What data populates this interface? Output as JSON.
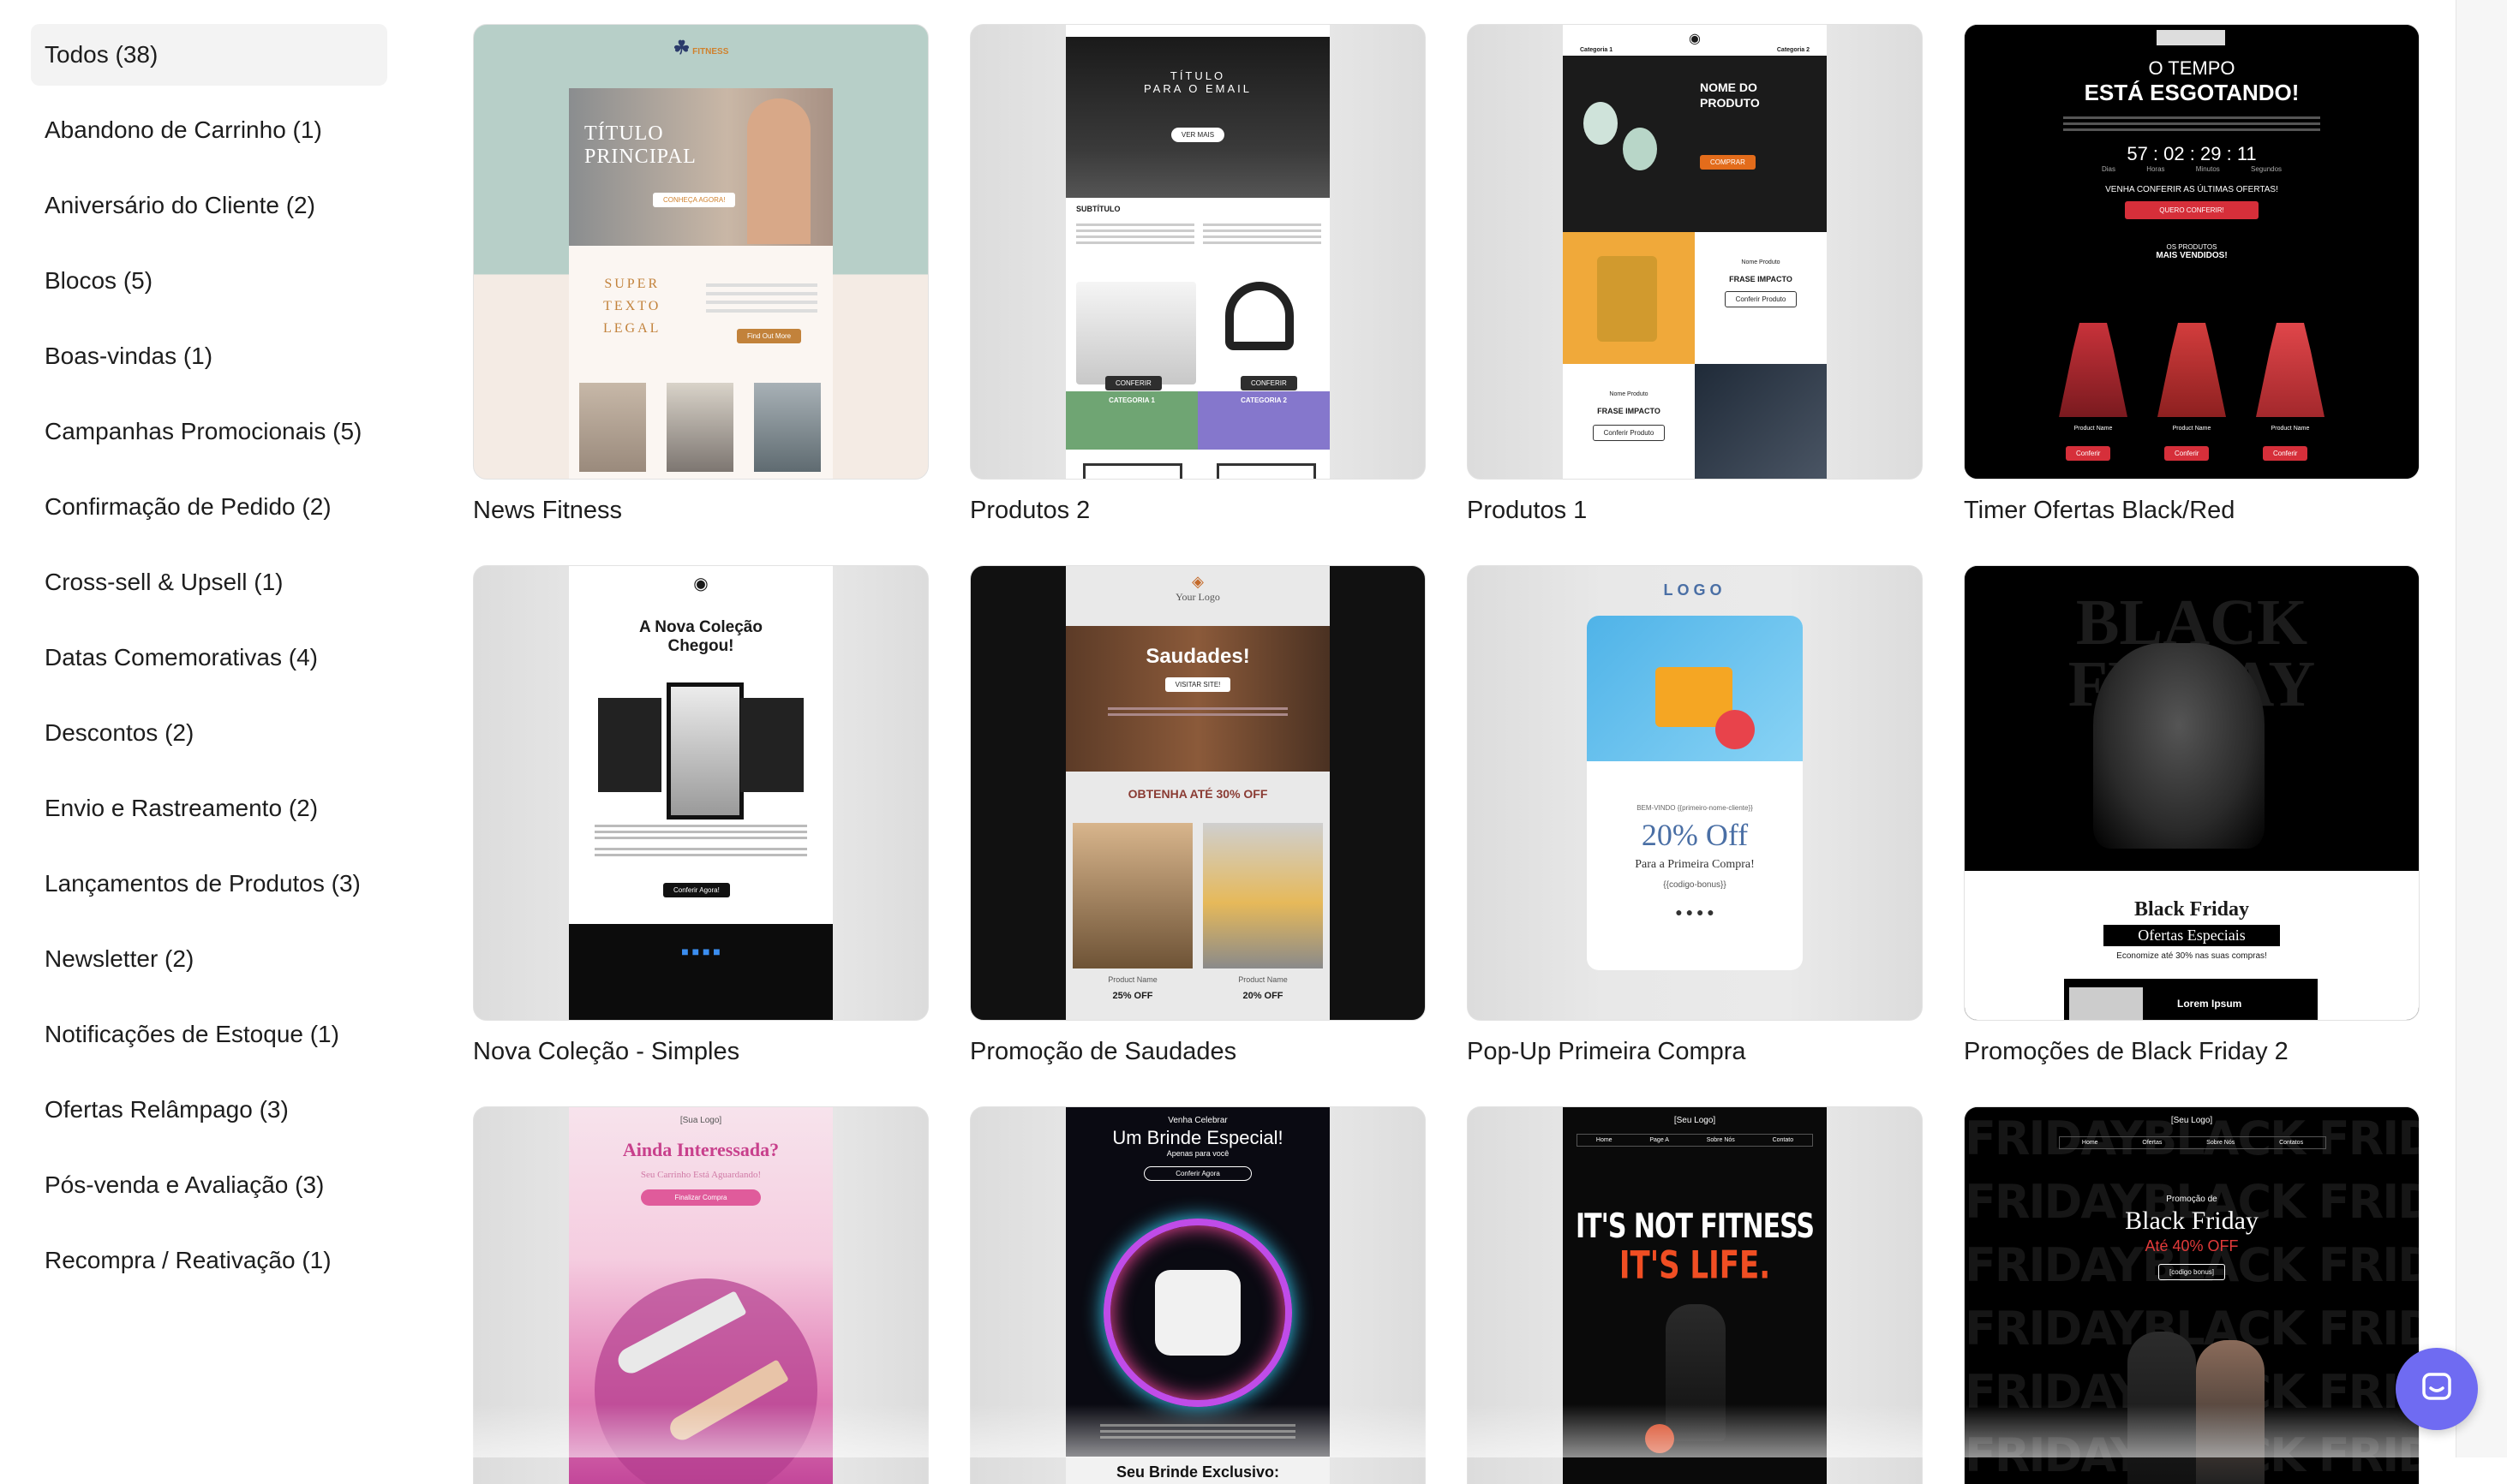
{
  "sidebar": {
    "categories": [
      {
        "label": "Todos (38)"
      },
      {
        "label": "Abandono de Carrinho (1)"
      },
      {
        "label": "Aniversário do Cliente (2)"
      },
      {
        "label": "Blocos (5)"
      },
      {
        "label": "Boas-vindas (1)"
      },
      {
        "label": "Campanhas Promocionais (5)"
      },
      {
        "label": "Confirmação de Pedido (2)"
      },
      {
        "label": "Cross-sell & Upsell (1)"
      },
      {
        "label": "Datas Comemorativas (4)"
      },
      {
        "label": "Descontos (2)"
      },
      {
        "label": "Envio e Rastreamento (2)"
      },
      {
        "label": "Lançamentos de Produtos (3)"
      },
      {
        "label": "Newsletter (2)"
      },
      {
        "label": "Notificações de Estoque (1)"
      },
      {
        "label": "Ofertas Relâmpago (3)"
      },
      {
        "label": "Pós-venda e Avaliação (3)"
      },
      {
        "label": "Recompra / Reativação (1)"
      }
    ]
  },
  "templates": [
    {
      "title": "News Fitness",
      "preview": {
        "brand": "FITNESS",
        "heading1": "TÍTULO",
        "heading2": "PRINCIPAL",
        "cta": "CONHEÇA AGORA!",
        "subheading": [
          "SUPER",
          "TEXTO",
          "LEGAL"
        ],
        "button": "Find Out More"
      }
    },
    {
      "title": "Produtos 2",
      "preview": {
        "heading1": "TÍTULO",
        "heading2": "PARA O EMAIL",
        "cta": "VER MAIS",
        "subtitle": "SUBTÍTULO",
        "btn": "CONFERIR",
        "cat1": "CATEGORIA 1",
        "cat2": "CATEGORIA 2"
      }
    },
    {
      "title": "Produtos 1",
      "preview": {
        "tab1": "Categoria 1",
        "tab2": "Categoria 2",
        "name1": "NOME DO",
        "name2": "PRODUTO",
        "buy": "COMPRAR",
        "small": "Nome Produto",
        "impact": "FRASE IMPACTO",
        "btn": "Conferir Produto"
      }
    },
    {
      "title": "Timer Ofertas Black/Red",
      "preview": {
        "pre": "O TEMPO",
        "headline": "ESTÁ ESGOTANDO!",
        "d": "57",
        "h": "02",
        "m": "29",
        "s": "11",
        "dl": "Dias",
        "hl": "Horas",
        "ml": "Minutos",
        "sl": "Segundos",
        "offer": "VENHA CONFERIR AS ÚLTIMAS OFERTAS!",
        "cta": "QUERO CONFERIR!",
        "sub": "OS PRODUTOS",
        "best": "MAIS VENDIDOS!",
        "pname": "Product Name",
        "btn": "Conferir"
      }
    },
    {
      "title": "Nova Coleção - Simples",
      "preview": {
        "h1": "A Nova Coleção",
        "h2": "Chegou!",
        "btn": "Conferir Agora!"
      }
    },
    {
      "title": "Promoção de Saudades",
      "preview": {
        "logo": "Your Logo",
        "headline": "Saudades!",
        "cta": "VISITAR SITE!",
        "offer": "OBTENHA ATÉ 30% OFF",
        "pname": "Product Name",
        "off1": "25% OFF",
        "off2": "20% OFF"
      }
    },
    {
      "title": "Pop-Up Primeira Compra",
      "preview": {
        "logo": "LOGO",
        "welcome": "BEM-VINDO {{primeiro-nome-cliente}}",
        "off": "20% Off",
        "sub": "Para a Primeira Compra!",
        "code": "{{codigo-bonus}}"
      }
    },
    {
      "title": "Promoções de Black Friday 2",
      "preview": {
        "bg": "BLACK FRIDAY",
        "h": "Black Friday",
        "sub": "Ofertas Especiais",
        "small": "Economize até 30% nas suas compras!",
        "lorem": "Lorem Ipsum"
      }
    },
    {
      "title": "",
      "preview": {
        "logo": "[Sua Logo]",
        "h": "Ainda Interessada?",
        "sub": "Seu Carrinho Está Aguardando!",
        "btn": "Finalizar Compra"
      }
    },
    {
      "title": "",
      "preview": {
        "pre": "Venha Celebrar",
        "h": "Um Brinde Especial!",
        "sub": "Apenas para você",
        "btn": "Conferir Agora",
        "foot": "Seu Brinde Exclusivo:"
      }
    },
    {
      "title": "",
      "preview": {
        "logo": "[Seu Logo]",
        "nav": [
          "Home",
          "Page A",
          "Sobre Nós",
          "Contato"
        ],
        "h1": "IT'S NOT FITNESS",
        "h2": "IT'S LIFE."
      }
    },
    {
      "title": "",
      "preview": {
        "logo": "[Seu Logo]",
        "nav": [
          "Home",
          "Ofertas",
          "Sobre Nós",
          "Contatos"
        ],
        "pre": "Promoção de",
        "h": "Black Friday",
        "off": "Até 40% OFF",
        "code": "[codigo bonus]",
        "bg": "FRIDAYBLACK FRIDAYBLACK"
      }
    }
  ],
  "colors": {
    "accent": "#6f6bf2",
    "active_bg": "#f3f3f3"
  }
}
